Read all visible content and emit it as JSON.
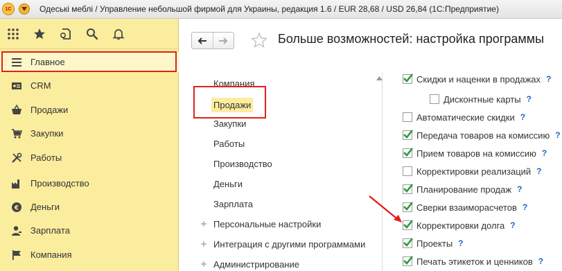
{
  "window": {
    "title": "Одеські меблі / Управление небольшой фирмой для Украины, редакция 1.6 / EUR 28,68 / USD 26,84  (1С:Предприятие)",
    "logo_text": "1С"
  },
  "toolbar": {
    "icons": [
      "apps-grid-icon",
      "star-icon",
      "history-icon",
      "search-icon",
      "bell-icon"
    ]
  },
  "sidebar": {
    "items": [
      {
        "label": "Главное",
        "icon": "menu-lines-icon"
      },
      {
        "label": "CRM",
        "icon": "id-card-icon"
      },
      {
        "label": "Продажи",
        "icon": "basket-icon"
      },
      {
        "label": "Закупки",
        "icon": "cart-icon"
      },
      {
        "label": "Работы",
        "icon": "tools-icon"
      },
      {
        "label": "Производство",
        "icon": "factory-icon"
      },
      {
        "label": "Деньги",
        "icon": "coin-icon"
      },
      {
        "label": "Зарплата",
        "icon": "person-icon"
      },
      {
        "label": "Компания",
        "icon": "flag-icon"
      }
    ]
  },
  "main": {
    "title": "Больше возможностей: настройка программы",
    "sections": [
      {
        "label": "Компания",
        "expandable": false
      },
      {
        "label": "Продажи",
        "expandable": false,
        "selected": true
      },
      {
        "label": "Закупки",
        "expandable": false
      },
      {
        "label": "Работы",
        "expandable": false
      },
      {
        "label": "Производство",
        "expandable": false
      },
      {
        "label": "Деньги",
        "expandable": false
      },
      {
        "label": "Зарплата",
        "expandable": false
      },
      {
        "label": "Персональные настройки",
        "expandable": true
      },
      {
        "label": "Интеграция с другими программами",
        "expandable": true
      },
      {
        "label": "Администрирование",
        "expandable": true
      }
    ],
    "options": [
      {
        "label": "Скидки и наценки в продажах",
        "checked": true,
        "help": "?"
      },
      {
        "label": "Дисконтные карты",
        "checked": false,
        "help": "?",
        "indent": true
      },
      {
        "label": "Автоматические скидки",
        "checked": false,
        "help": "?"
      },
      {
        "label": "Передача товаров на комиссию",
        "checked": true,
        "help": "?"
      },
      {
        "label": "Прием товаров на комиссию",
        "checked": true,
        "help": "?"
      },
      {
        "label": "Корректировки реализаций",
        "checked": false,
        "help": "?"
      },
      {
        "label": "Планирование продаж",
        "checked": true,
        "help": "?"
      },
      {
        "label": "Сверки взаиморасчетов",
        "checked": true,
        "help": "?"
      },
      {
        "label": "Корректировки долга",
        "checked": true,
        "help": "?"
      },
      {
        "label": "Проекты",
        "checked": true,
        "help": "?"
      },
      {
        "label": "Печать этикеток и ценников",
        "checked": true,
        "help": "?"
      }
    ]
  },
  "colors": {
    "sidebar_bg": "#fbed9e",
    "highlight": "#e0201c",
    "check": "#2e9b3b",
    "help": "#1d63c4"
  }
}
